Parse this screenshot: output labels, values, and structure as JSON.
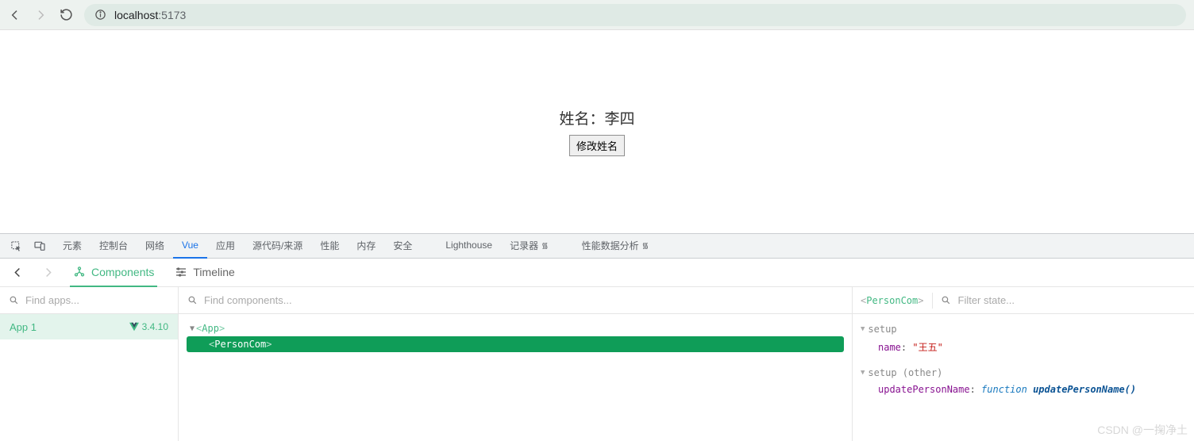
{
  "browser": {
    "url_display_host": "localhost",
    "url_display_port": ":5173"
  },
  "page": {
    "name_text": "姓名：李四",
    "button_label": "修改姓名"
  },
  "devtools_tabs": {
    "elements": "元素",
    "console": "控制台",
    "network": "网络",
    "vue": "Vue",
    "application": "应用",
    "sources": "源代码/来源",
    "performance": "性能",
    "memory": "内存",
    "security": "安全",
    "lighthouse": "Lighthouse",
    "recorder": "记录器",
    "perf_insights": "性能数据分析"
  },
  "vue_subtabs": {
    "components": "Components",
    "timeline": "Timeline"
  },
  "apps_panel": {
    "search_placeholder": "Find apps...",
    "items": [
      {
        "name": "App 1",
        "version": "3.4.10"
      }
    ]
  },
  "tree_panel": {
    "search_placeholder": "Find components...",
    "root_tag": "App",
    "selected_tag": "PersonCom"
  },
  "state_panel": {
    "component_name": "PersonCom",
    "filter_placeholder": "Filter state...",
    "groups": [
      {
        "title": "setup",
        "props": [
          {
            "key": "name",
            "type": "string",
            "value": "\"王五\""
          }
        ]
      },
      {
        "title": "setup (other)",
        "props": [
          {
            "key": "updatePersonName",
            "type": "function",
            "value": "updatePersonName()"
          }
        ]
      }
    ]
  },
  "watermark": "CSDN @一掬净土"
}
